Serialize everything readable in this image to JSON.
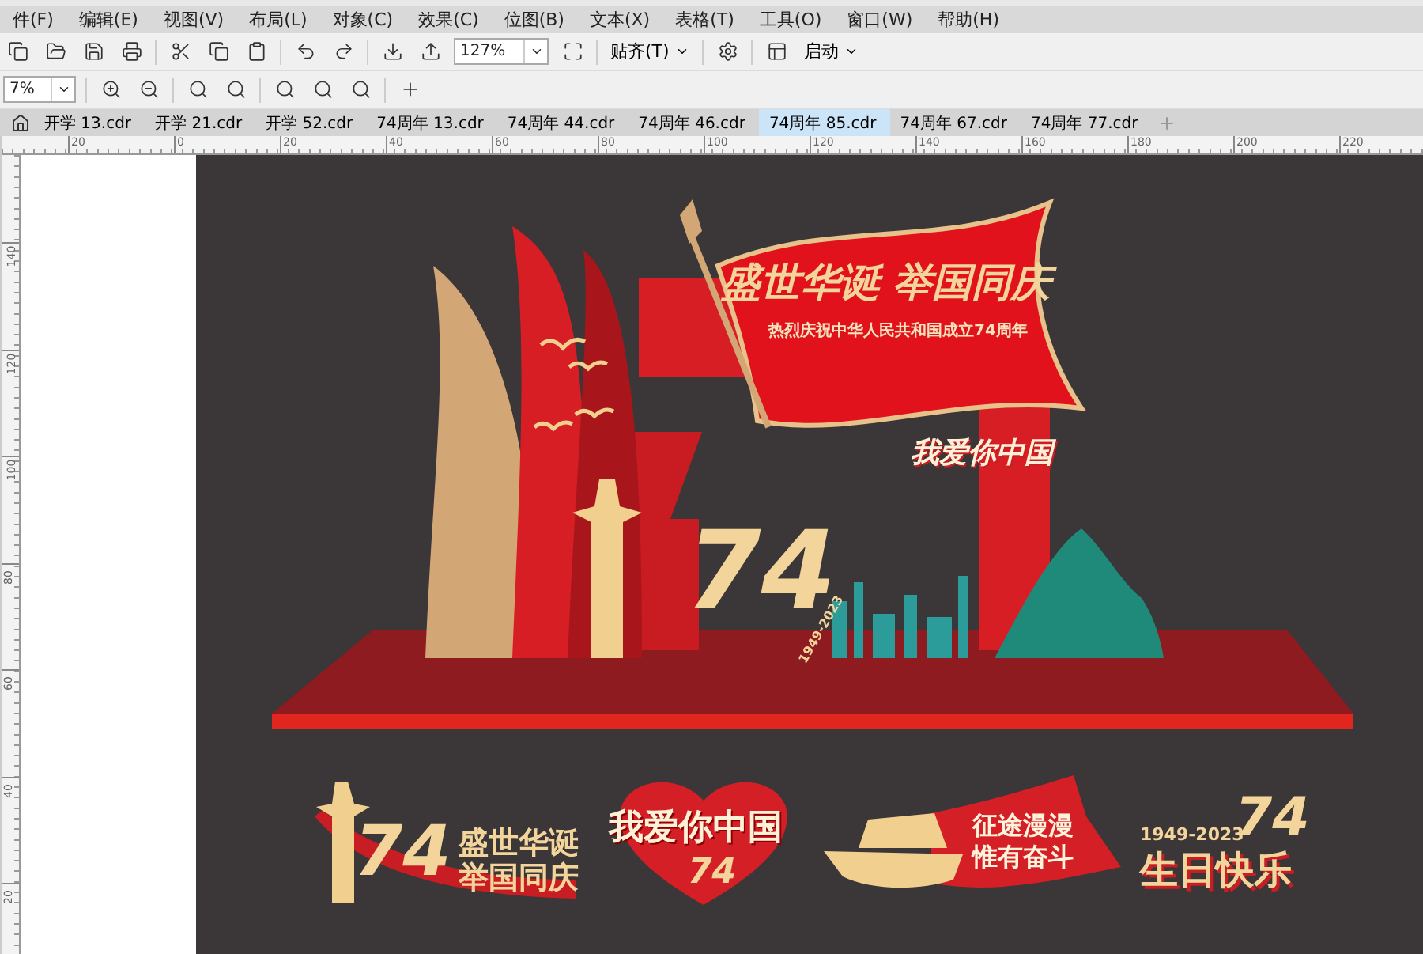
{
  "menu": [
    "件(F)",
    "编辑(E)",
    "视图(V)",
    "布局(L)",
    "对象(C)",
    "效果(C)",
    "位图(B)",
    "文本(X)",
    "表格(T)",
    "工具(O)",
    "窗口(W)",
    "帮助(H)"
  ],
  "toolbar": {
    "zoom": "127%",
    "snap": "贴齐(T)",
    "launch": "启动"
  },
  "toolbar2": {
    "zoom": "7%"
  },
  "tabs": [
    {
      "label": "开学 13.cdr",
      "selected": false
    },
    {
      "label": "开学 21.cdr",
      "selected": false
    },
    {
      "label": "开学 52.cdr",
      "selected": false
    },
    {
      "label": "74周年 13.cdr",
      "selected": false
    },
    {
      "label": "74周年 44.cdr",
      "selected": false
    },
    {
      "label": "74周年 46.cdr",
      "selected": false
    },
    {
      "label": "74周年 85.cdr",
      "selected": true
    },
    {
      "label": "74周年 67.cdr",
      "selected": false
    },
    {
      "label": "74周年 77.cdr",
      "selected": false
    }
  ],
  "ruler": {
    "horizontal": [
      "20",
      "0",
      "20",
      "40",
      "60",
      "80",
      "100",
      "120",
      "140",
      "160",
      "180",
      "200",
      "220"
    ],
    "vertical": [
      "140",
      "120",
      "100",
      "80",
      "60",
      "40",
      "20"
    ]
  },
  "artwork": {
    "banner_title": "盛世华诞 举国同庆",
    "banner_subtitle": "热烈庆祝中华人民共和国成立74周年",
    "slogan": "我爱你中国",
    "number": "74",
    "years": "1949-2023"
  },
  "stickers": [
    {
      "kind": "tower",
      "number": "74",
      "lines": [
        "盛世华诞",
        "举国同庆"
      ]
    },
    {
      "kind": "heart",
      "lines": [
        "我爱你中国"
      ],
      "number": "74"
    },
    {
      "kind": "boat",
      "lines": [
        "征途漫漫",
        "惟有奋斗"
      ]
    },
    {
      "kind": "birthday",
      "years": "1949-2023",
      "number": "74",
      "lines": [
        "生日快乐"
      ]
    }
  ]
}
